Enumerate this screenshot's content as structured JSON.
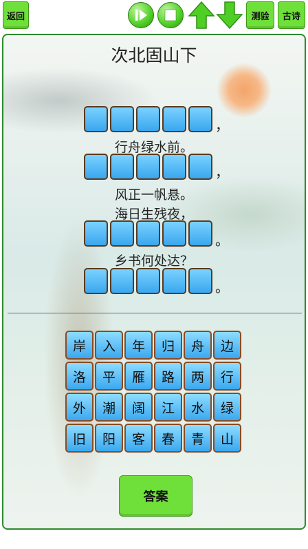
{
  "toolbar": {
    "back_label": "返回",
    "test_label": "测验",
    "poem_label": "古诗",
    "play_icon": "play-pause-icon",
    "stop_icon": "stop-icon",
    "up_icon": "arrow-up-icon",
    "down_icon": "arrow-down-icon"
  },
  "poem": {
    "title": "次北固山下",
    "lines": [
      {
        "type": "blank",
        "count": 5,
        "punct": "，"
      },
      {
        "type": "text",
        "text": "行舟绿水前。"
      },
      {
        "type": "blank",
        "count": 5,
        "punct": "，"
      },
      {
        "type": "text",
        "text": "风正一帆悬。"
      },
      {
        "type": "text",
        "text": "海日生残夜，"
      },
      {
        "type": "blank",
        "count": 5,
        "punct": "。"
      },
      {
        "type": "text",
        "text": "乡书何处达？"
      },
      {
        "type": "blank",
        "count": 5,
        "punct": "。"
      }
    ]
  },
  "characters": [
    [
      "岸",
      "入",
      "年",
      "归",
      "舟",
      "边"
    ],
    [
      "洛",
      "平",
      "雁",
      "路",
      "两",
      "行"
    ],
    [
      "外",
      "潮",
      "阔",
      "江",
      "水",
      "绿"
    ],
    [
      "旧",
      "阳",
      "客",
      "春",
      "青",
      "山"
    ]
  ],
  "answer_label": "答案",
  "colors": {
    "button_green": "#6fe03a",
    "tile_blue": "#3ba8ef",
    "tile_border": "#8a4a22",
    "panel_border": "#2e8a2e"
  }
}
